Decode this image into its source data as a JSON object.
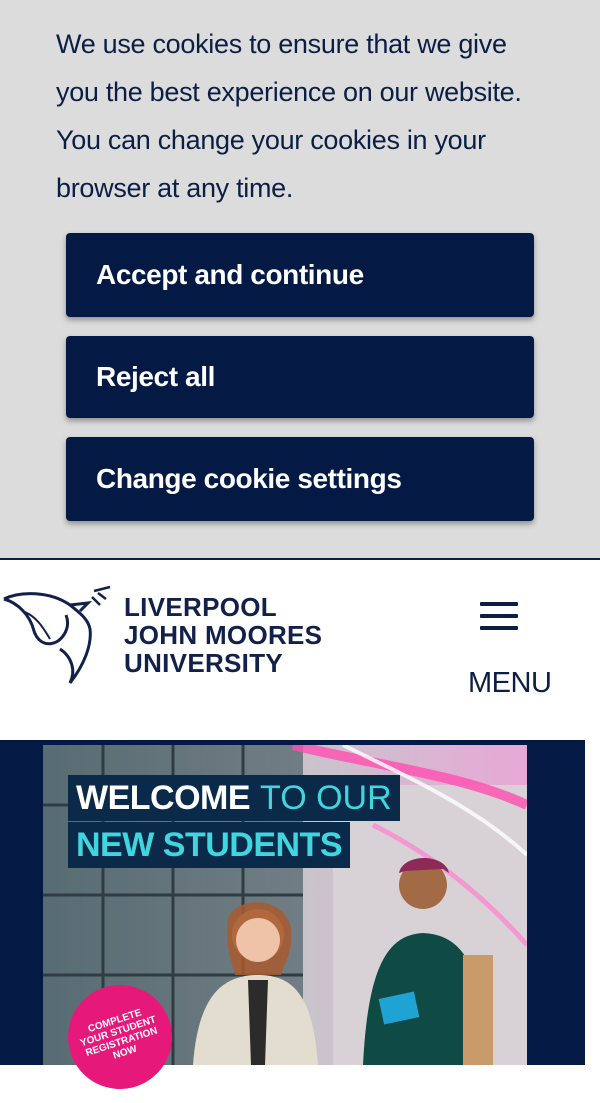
{
  "cookie_banner": {
    "message": "We use cookies to ensure that we give you the best experience on our website. You can change your cookies in your browser at any time.",
    "accept_label": "Accept and continue",
    "reject_label": "Reject all",
    "settings_label": "Change cookie settings"
  },
  "header": {
    "logo_lines": [
      "LIVERPOOL",
      "JOHN MOORES",
      "UNIVERSITY"
    ],
    "menu_label": "MENU"
  },
  "hero": {
    "headline_bold": "WELCOME",
    "headline_light": "TO OUR",
    "headline_line2": "NEW STUDENTS",
    "badge_text": "COMPLETE YOUR STUDENT REGISTRATION NOW"
  },
  "colors": {
    "navy": "#041a45",
    "banner_bg": "#dcdcdc",
    "accent_cyan": "#3fd6e0",
    "accent_pink": "#e6197a"
  }
}
